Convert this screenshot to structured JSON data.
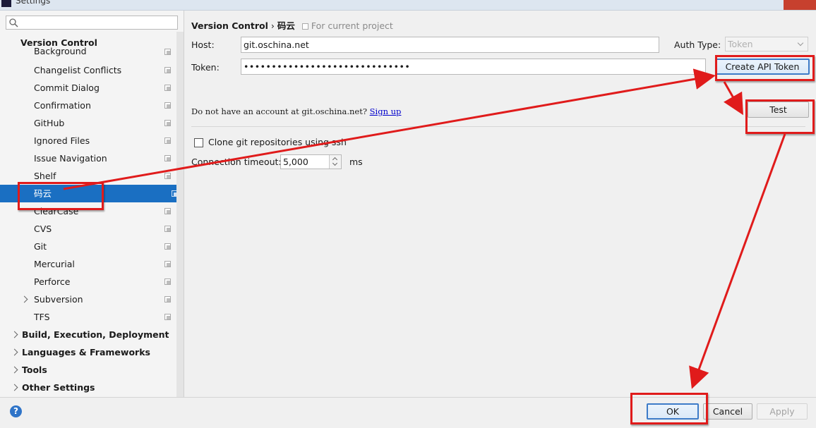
{
  "window": {
    "title": "Settings"
  },
  "sidebar": {
    "search_placeholder": "",
    "section_title": "Version Control",
    "items": [
      {
        "label": "Background",
        "selected": false
      },
      {
        "label": "Changelist Conflicts",
        "selected": false
      },
      {
        "label": "Commit Dialog",
        "selected": false
      },
      {
        "label": "Confirmation",
        "selected": false
      },
      {
        "label": "GitHub",
        "selected": false
      },
      {
        "label": "Ignored Files",
        "selected": false
      },
      {
        "label": "Issue Navigation",
        "selected": false
      },
      {
        "label": "Shelf",
        "selected": false
      },
      {
        "label": "码云",
        "selected": true
      },
      {
        "label": "ClearCase",
        "selected": false
      },
      {
        "label": "CVS",
        "selected": false
      },
      {
        "label": "Git",
        "selected": false
      },
      {
        "label": "Mercurial",
        "selected": false
      },
      {
        "label": "Perforce",
        "selected": false
      },
      {
        "label": "Subversion",
        "selected": false,
        "expandable": true
      },
      {
        "label": "TFS",
        "selected": false
      }
    ],
    "sections": [
      {
        "label": "Build, Execution, Deployment"
      },
      {
        "label": "Languages & Frameworks"
      },
      {
        "label": "Tools"
      },
      {
        "label": "Other Settings"
      }
    ]
  },
  "breadcrumb": {
    "parent": "Version Control",
    "separator": "›",
    "current": "码云",
    "scope_note": "For current project"
  },
  "form": {
    "host_label": "Host:",
    "host_value": "git.oschina.net",
    "auth_type_label": "Auth Type:",
    "auth_type_value": "Token",
    "token_label": "Token:",
    "token_value": "••••••••••••••••••••••••••••••",
    "create_token_button": "Create API Token",
    "test_button": "Test",
    "signup_text": "Do not have an account at git.oschina.net?",
    "signup_link": "Sign up",
    "clone_ssh_label": "Clone git repositories using ssh",
    "clone_ssh_checked": false,
    "timeout_label": "Connection timeout:",
    "timeout_value": "5,000",
    "timeout_unit": "ms"
  },
  "footer": {
    "help_icon": "?",
    "ok_button": "OK",
    "cancel_button": "Cancel",
    "apply_button": "Apply"
  },
  "colors": {
    "selection": "#1a6fc2",
    "annotation_red": "#e01b1b",
    "link": "#0000cc"
  }
}
